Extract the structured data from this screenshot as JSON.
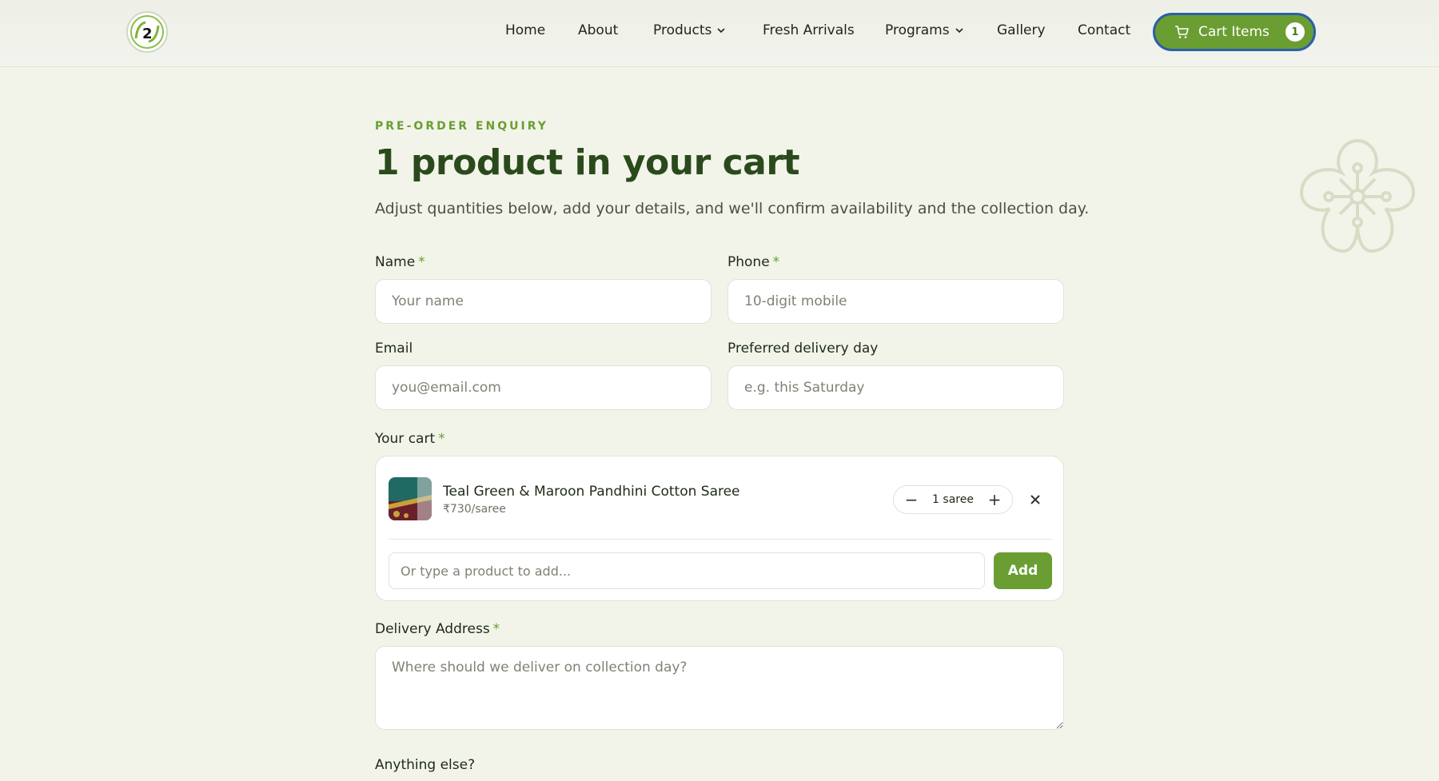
{
  "colors": {
    "accent": "#6a9e33",
    "heading": "#2b4a1c",
    "background": "#f2f4e9",
    "cart_border": "#2c5fa7"
  },
  "nav": {
    "items": [
      {
        "label": "Home"
      },
      {
        "label": "About"
      },
      {
        "label": "Products",
        "has_dropdown": true
      },
      {
        "label": "Fresh Arrivals"
      },
      {
        "label": "Programs",
        "has_dropdown": true
      },
      {
        "label": "Gallery"
      },
      {
        "label": "Contact"
      }
    ],
    "cart": {
      "label": "Cart Items",
      "count": "1",
      "icon": "cart-icon"
    }
  },
  "main": {
    "eyebrow": "PRE-ORDER ENQUIRY",
    "title": "1 product in your cart",
    "subtitle": "Adjust quantities below, add your details, and we'll confirm availability and the collection day."
  },
  "form": {
    "name": {
      "label": "Name",
      "required": "*",
      "placeholder": "Your name"
    },
    "phone": {
      "label": "Phone",
      "required": "*",
      "placeholder": "10-digit mobile"
    },
    "email": {
      "label": "Email",
      "placeholder": "you@email.com"
    },
    "delivery_day": {
      "label": "Preferred delivery day",
      "placeholder": "e.g. this Saturday"
    },
    "cart": {
      "label": "Your cart",
      "required": "*",
      "items": [
        {
          "name": "Teal Green & Maroon Pandhini Cotton Saree",
          "price": "₹730/saree",
          "quantity": "1 saree"
        }
      ],
      "add_placeholder": "Or type a product to add...",
      "add_label": "Add"
    },
    "address": {
      "label": "Delivery Address",
      "required": "*",
      "placeholder": "Where should we deliver on collection day?"
    },
    "anything_else": {
      "label": "Anything else?"
    }
  }
}
